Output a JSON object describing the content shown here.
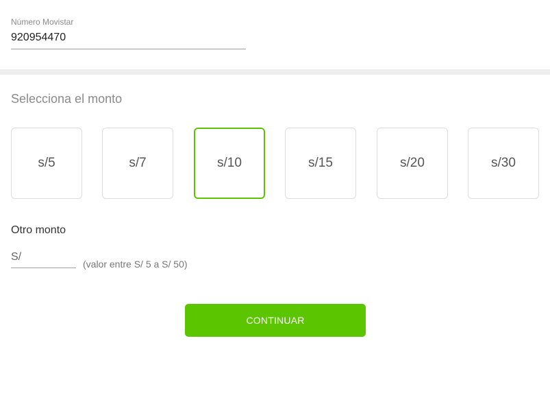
{
  "phone": {
    "label": "Número Movistar",
    "value": "920954470"
  },
  "amounts": {
    "title": "Selecciona el monto",
    "options": [
      {
        "label": "s/5",
        "selected": false
      },
      {
        "label": "s/7",
        "selected": false
      },
      {
        "label": "s/10",
        "selected": true
      },
      {
        "label": "s/15",
        "selected": false
      },
      {
        "label": "s/20",
        "selected": false
      },
      {
        "label": "s/30",
        "selected": false
      }
    ]
  },
  "other_amount": {
    "title": "Otro monto",
    "placeholder": "S/",
    "hint": "(valor entre S/ 5 a S/ 50)"
  },
  "continue_button": {
    "label": "CONTINUAR"
  },
  "colors": {
    "accent": "#5bc500",
    "divider": "#eeeeee"
  }
}
